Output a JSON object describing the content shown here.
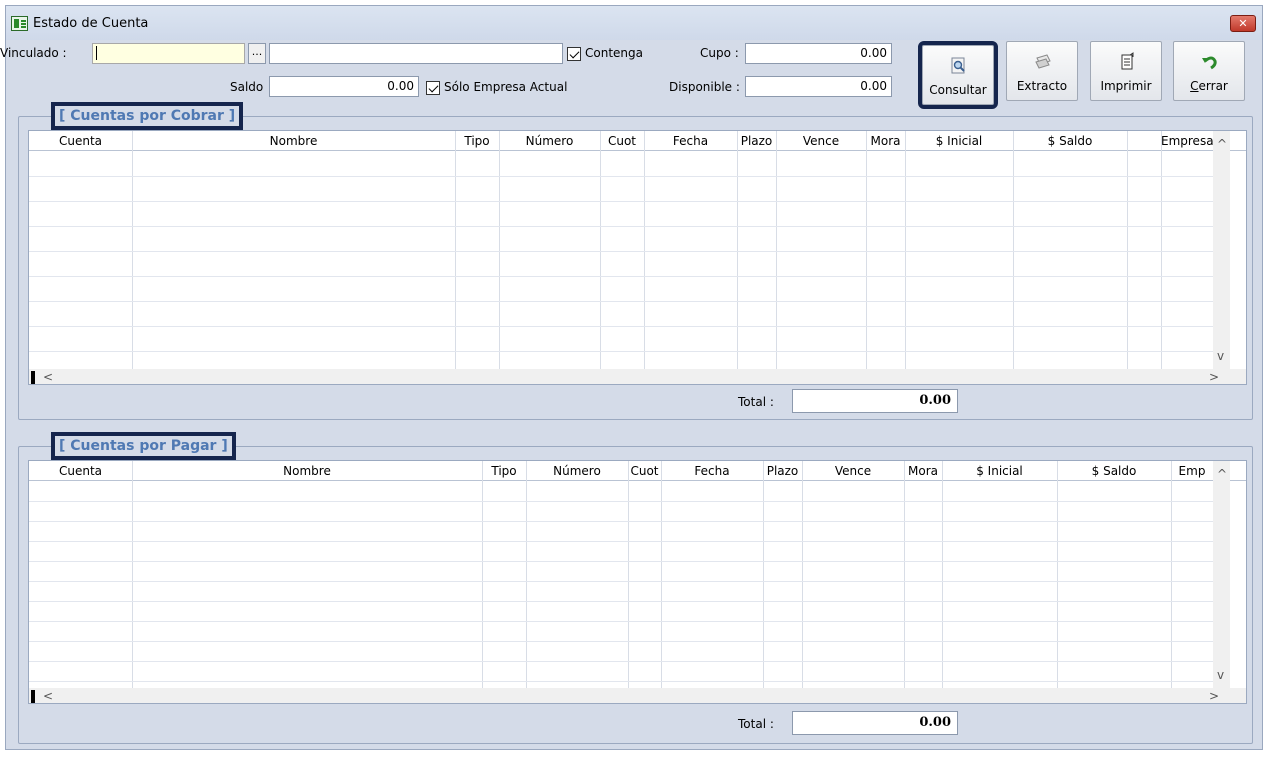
{
  "window": {
    "title": "Estado de Cuenta",
    "close_glyph": "✕"
  },
  "form": {
    "vinculado_label": "Vinculado :",
    "vinculado_code": "",
    "vinculado_lookup": "...",
    "vinculado_name": "",
    "contenga_label": "Contenga",
    "contenga_checked": true,
    "saldo_label": "Saldo",
    "saldo_value": "0.00",
    "solo_empresa_label": "Sólo Empresa Actual",
    "solo_empresa_checked": true,
    "cupo_label": "Cupo :",
    "cupo_value": "0.00",
    "disponible_label": "Disponible :",
    "disponible_value": "0.00"
  },
  "toolbar": {
    "consultar": {
      "label": "Consultar",
      "icon": "magnifier-document-icon"
    },
    "extracto": {
      "label": "Extracto",
      "icon": "printer-paper-icon"
    },
    "imprimir": {
      "label": "Imprimir",
      "icon": "document-stack-icon"
    },
    "cerrar": {
      "label_prefix": "",
      "label_underlined": "C",
      "label_rest": "errar",
      "icon": "undo-arrow-icon"
    }
  },
  "cobrar": {
    "title": "[ Cuentas por Cobrar ]",
    "columns": [
      "Cuenta",
      "Nombre",
      "Tipo",
      "Número",
      "Cuot",
      "Fecha",
      "Plazo",
      "Vence",
      "Mora",
      "$ Inicial",
      "$ Saldo",
      "",
      "Empresa"
    ],
    "total_label": "Total :",
    "total_value": "0.00"
  },
  "pagar": {
    "title": "[ Cuentas por Pagar ]",
    "columns": [
      "Cuenta",
      "Nombre",
      "Tipo",
      "Número",
      "Cuot",
      "Fecha",
      "Plazo",
      "Vence",
      "Mora",
      "$ Inicial",
      "$ Saldo",
      "Emp"
    ],
    "total_label": "Total :",
    "total_value": "0.00"
  },
  "scroll": {
    "left": "<",
    "right": ">",
    "up": "^",
    "down": "v"
  },
  "colors": {
    "window_bg": "#d4dbe8",
    "group_title": "#4f79b3",
    "focus_outline": "#15254d",
    "input_yellow": "#ffffe1"
  }
}
